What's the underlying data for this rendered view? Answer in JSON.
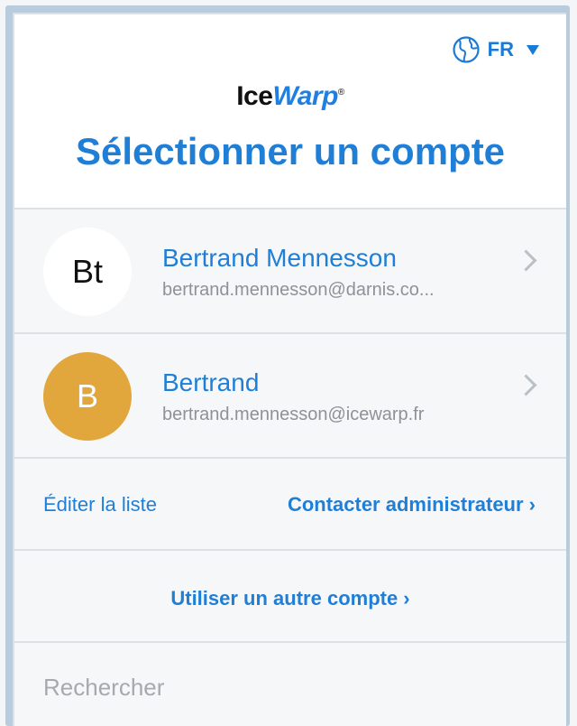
{
  "language": {
    "code": "FR",
    "icon": "globe-icon"
  },
  "logo": {
    "prefix": "Ice",
    "accent": "Warp",
    "mark": "®"
  },
  "title": "Sélectionner un compte",
  "accounts": [
    {
      "initials": "Bt",
      "name": "Bertrand Mennesson",
      "email": "bertrand.mennesson@darnis.co...",
      "avatar_color": "#ffffff"
    },
    {
      "initials": "B",
      "name": "Bertrand",
      "email": "bertrand.mennesson@icewarp.fr",
      "avatar_color": "#e2a73c"
    }
  ],
  "actions": {
    "edit": "Éditer la liste",
    "contact_admin": "Contacter administrateur ›"
  },
  "other_account": "Utiliser un autre compte ›",
  "search": {
    "placeholder": "Rechercher",
    "value": ""
  },
  "colors": {
    "accent": "#1f7fd6",
    "avatar_gold": "#e2a73c"
  }
}
